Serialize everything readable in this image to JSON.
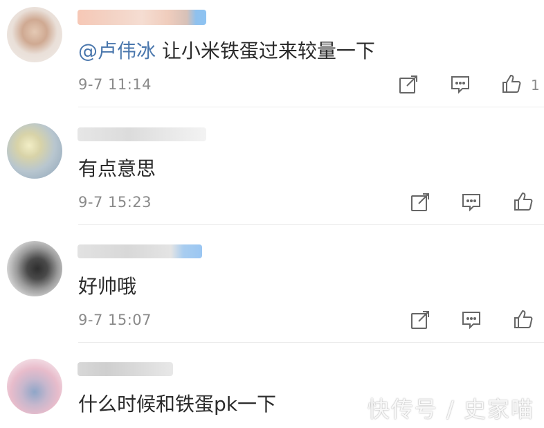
{
  "comments": [
    {
      "mention": "@卢伟冰",
      "text": " 让小米铁蛋过来较量一下",
      "time": "9-7 11:14",
      "likes": "1"
    },
    {
      "text": "有点意思",
      "time": "9-7 15:23"
    },
    {
      "text": "好帅哦",
      "time": "9-7 15:07"
    },
    {
      "text": "什么时候和铁蛋pk一下"
    }
  ],
  "icons": {
    "share": "share-edit-icon",
    "comment": "comment-icon",
    "like": "thumbs-up-icon"
  },
  "colors": {
    "mention": "#4a77ad",
    "meta": "#8a8a8a"
  },
  "watermark": "快传号 / 史家喵"
}
